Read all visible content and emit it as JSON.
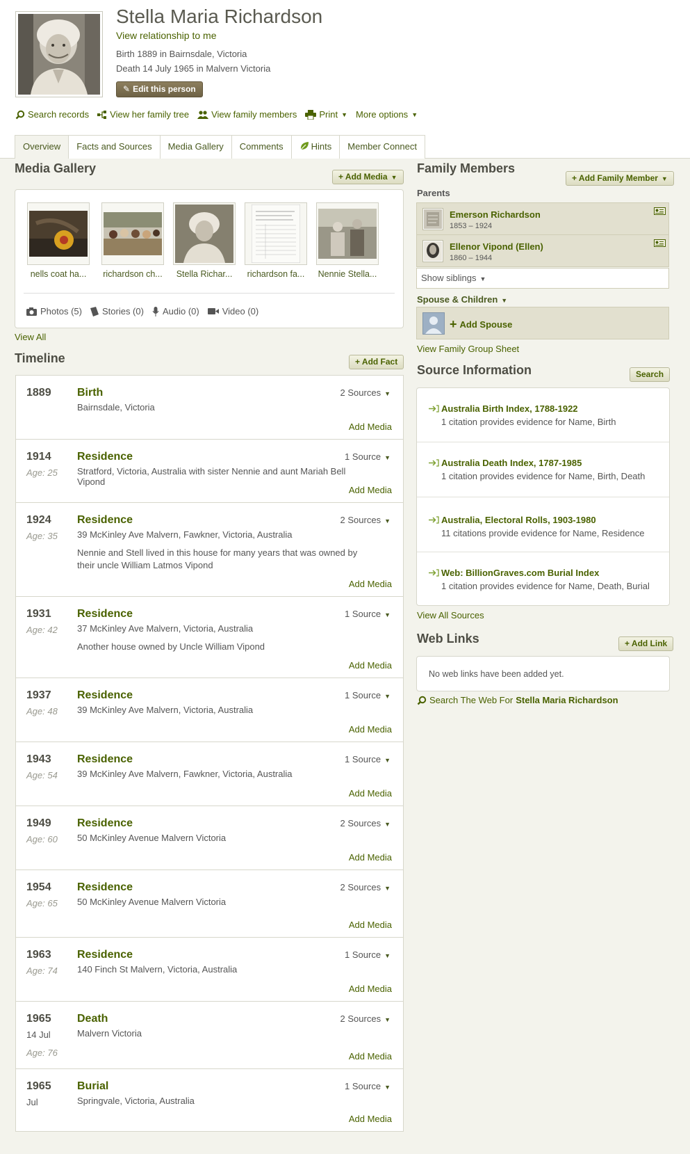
{
  "person": {
    "name": "Stella Maria Richardson",
    "view_relationship": "View relationship to me",
    "birth": "Birth 1889 in Bairnsdale, Victoria",
    "death": "Death 14 July 1965 in Malvern Victoria",
    "edit_label": "Edit this person"
  },
  "actions": {
    "search_records": "Search records",
    "view_tree": "View her family tree",
    "view_family": "View family members",
    "print": "Print",
    "more_options": "More options"
  },
  "tabs": [
    "Overview",
    "Facts and Sources",
    "Media Gallery",
    "Comments",
    "Hints",
    "Member Connect"
  ],
  "media_gallery": {
    "title": "Media Gallery",
    "add_label": "+ Add Media",
    "thumbs": [
      "nells coat ha...",
      "richardson ch...",
      "Stella Richar...",
      "richardson fa...",
      "Nennie Stella..."
    ],
    "photos": "Photos (5)",
    "stories": "Stories (0)",
    "audio": "Audio (0)",
    "video": "Video (0)",
    "view_all": "View All"
  },
  "timeline": {
    "title": "Timeline",
    "add_label": "+ Add Fact",
    "add_media": "Add Media",
    "events": [
      {
        "year": "1889",
        "age": "",
        "date": "",
        "type": "Birth",
        "place": "Bairnsdale, Victoria",
        "desc": "",
        "sources": "2 Sources"
      },
      {
        "year": "1914",
        "age": "Age: 25",
        "date": "",
        "type": "Residence",
        "place": "Stratford, Victoria, Australia with sister Nennie and aunt Mariah Bell Vipond",
        "desc": "",
        "sources": "1 Source"
      },
      {
        "year": "1924",
        "age": "Age: 35",
        "date": "",
        "type": "Residence",
        "place": "39 McKinley Ave Malvern, Fawkner, Victoria, Australia",
        "desc": "Nennie and Stell lived in this house for many years that was owned by their uncle William Latmos Vipond",
        "sources": "2 Sources"
      },
      {
        "year": "1931",
        "age": "Age: 42",
        "date": "",
        "type": "Residence",
        "place": "37 McKinley Ave Malvern, Victoria, Australia",
        "desc": "Another house owned by Uncle William Vipond",
        "sources": "1 Source"
      },
      {
        "year": "1937",
        "age": "Age: 48",
        "date": "",
        "type": "Residence",
        "place": "39 McKinley Ave Malvern, Victoria, Australia",
        "desc": "",
        "sources": "1 Source"
      },
      {
        "year": "1943",
        "age": "Age: 54",
        "date": "",
        "type": "Residence",
        "place": "39 McKinley Ave Malvern, Fawkner, Victoria, Australia",
        "desc": "",
        "sources": "1 Source"
      },
      {
        "year": "1949",
        "age": "Age: 60",
        "date": "",
        "type": "Residence",
        "place": "50 McKinley Avenue Malvern Victoria",
        "desc": "",
        "sources": "2 Sources"
      },
      {
        "year": "1954",
        "age": "Age: 65",
        "date": "",
        "type": "Residence",
        "place": "50 McKinley Avenue Malvern Victoria",
        "desc": "",
        "sources": "2 Sources"
      },
      {
        "year": "1963",
        "age": "Age: 74",
        "date": "",
        "type": "Residence",
        "place": "140 Finch St Malvern, Victoria, Australia",
        "desc": "",
        "sources": "1 Source"
      },
      {
        "year": "1965",
        "age": "Age: 76",
        "date": "14 Jul",
        "type": "Death",
        "place": "Malvern Victoria",
        "desc": "",
        "sources": "2 Sources"
      },
      {
        "year": "1965",
        "age": "",
        "date": "Jul",
        "type": "Burial",
        "place": "Springvale, Victoria, Australia",
        "desc": "",
        "sources": "1 Source"
      }
    ]
  },
  "family": {
    "title": "Family Members",
    "add_label": "+ Add Family Member",
    "parents_label": "Parents",
    "parents": [
      {
        "name": "Emerson Richardson",
        "dates": "1853 – 1924"
      },
      {
        "name": "Ellenor Vipond (Ellen)",
        "dates": "1860 – 1944"
      }
    ],
    "show_siblings": "Show siblings",
    "spouse_label": "Spouse & Children",
    "add_spouse": "Add Spouse",
    "group_sheet": "View Family Group Sheet"
  },
  "sources": {
    "title": "Source Information",
    "search_label": "Search",
    "items": [
      {
        "title": "Australia Birth Index, 1788-1922",
        "cite": "1 citation provides evidence for Name, Birth"
      },
      {
        "title": "Australia Death Index, 1787-1985",
        "cite": "1 citation provides evidence for Name, Birth, Death"
      },
      {
        "title": "Australia, Electoral Rolls, 1903-1980",
        "cite": "11 citations provide evidence for Name, Residence"
      },
      {
        "title": "Web: BillionGraves.com Burial Index",
        "cite": "1 citation provides evidence for Name, Death, Burial"
      }
    ],
    "view_all": "View All Sources"
  },
  "web_links": {
    "title": "Web Links",
    "add_label": "+ Add Link",
    "empty": "No web links have been added yet.",
    "search_prefix": "Search The Web For",
    "search_name": "Stella Maria Richardson"
  },
  "colors": {
    "link_green": "#4a6200",
    "panel_beige": "#e2e0cf",
    "page_bg": "#f3f3ec",
    "edit_brown": "#7a6d50"
  }
}
